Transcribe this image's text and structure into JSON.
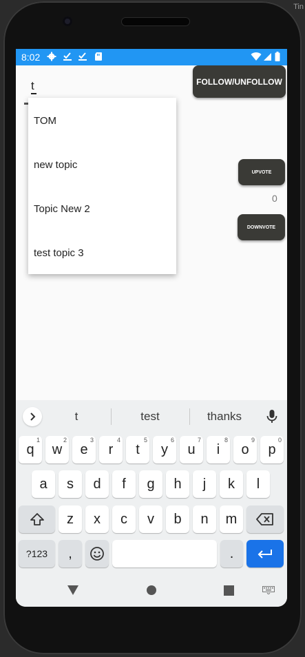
{
  "emulator_label": "Tin",
  "status_bar": {
    "time": "8:02",
    "left_icons": [
      "gear-icon",
      "check-download-icon",
      "check-download-icon",
      "sd-card-icon"
    ],
    "right_icons": [
      "wifi-icon",
      "signal-icon",
      "battery-icon"
    ],
    "color": "#2196f3"
  },
  "app": {
    "text_input_value": "t",
    "follow_button": "FOLLOW/UNFOLLOW",
    "upvote_button": "UPVOTE",
    "vote_count": "0",
    "downvote_button": "DOWNVOTE",
    "dropdown_options": [
      "TOM",
      "new topic",
      "Topic New 2",
      "test topic 3"
    ]
  },
  "keyboard": {
    "suggestions": [
      "t",
      "test",
      "thanks"
    ],
    "row1": [
      {
        "key": "q",
        "hint": "1"
      },
      {
        "key": "w",
        "hint": "2"
      },
      {
        "key": "e",
        "hint": "3"
      },
      {
        "key": "r",
        "hint": "4"
      },
      {
        "key": "t",
        "hint": "5"
      },
      {
        "key": "y",
        "hint": "6"
      },
      {
        "key": "u",
        "hint": "7"
      },
      {
        "key": "i",
        "hint": "8"
      },
      {
        "key": "o",
        "hint": "9"
      },
      {
        "key": "p",
        "hint": "0"
      }
    ],
    "row2": [
      "a",
      "s",
      "d",
      "f",
      "g",
      "h",
      "j",
      "k",
      "l"
    ],
    "row3": [
      "z",
      "x",
      "c",
      "v",
      "b",
      "n",
      "m"
    ],
    "symbols_key": "?123",
    "comma_key": ",",
    "period_key": ".",
    "accent_color": "#1a73e8"
  },
  "nav_bar": {
    "icons": [
      "back-triangle-icon",
      "home-circle-icon",
      "recents-square-icon",
      "keyboard-switch-icon"
    ]
  }
}
